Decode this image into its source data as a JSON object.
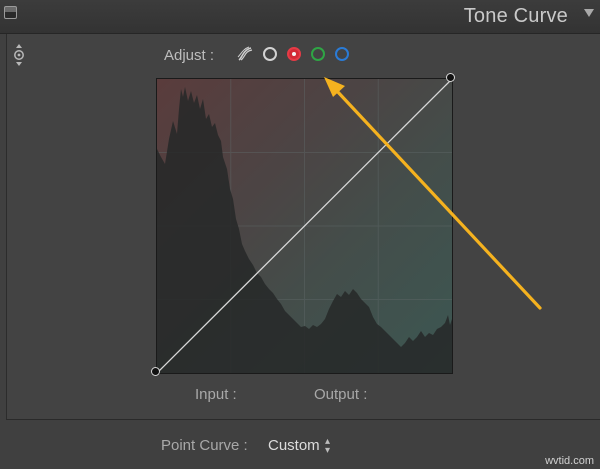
{
  "panel": {
    "title": "Tone Curve"
  },
  "adjust": {
    "label": "Adjust :",
    "channels": [
      {
        "name": "point-curve",
        "icon": "point-curve-icon"
      },
      {
        "name": "rgb",
        "color": "#d3d3d3"
      },
      {
        "name": "red",
        "color": "#d32a35",
        "selected": true
      },
      {
        "name": "green",
        "color": "#2fa545"
      },
      {
        "name": "blue",
        "color": "#2a7bd6"
      }
    ]
  },
  "curve": {
    "input_label": "Input :",
    "output_label": "Output :"
  },
  "point_curve": {
    "label": "Point Curve :",
    "value": "Custom"
  },
  "annotation": {
    "color": "#f5b21f"
  },
  "watermark": "wvtid.com"
}
